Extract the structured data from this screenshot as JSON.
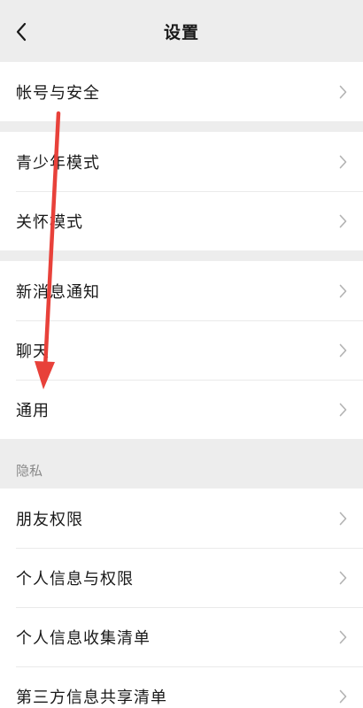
{
  "nav": {
    "title": "设置"
  },
  "groups": [
    {
      "items": [
        {
          "label": "帐号与安全"
        }
      ]
    },
    {
      "items": [
        {
          "label": "青少年模式"
        },
        {
          "label": "关怀模式"
        }
      ]
    },
    {
      "items": [
        {
          "label": "新消息通知"
        },
        {
          "label": "聊天"
        },
        {
          "label": "通用"
        }
      ]
    }
  ],
  "privacy": {
    "header": "隐私",
    "items": [
      {
        "label": "朋友权限"
      },
      {
        "label": "个人信息与权限"
      },
      {
        "label": "个人信息收集清单"
      },
      {
        "label": "第三方信息共享清单"
      }
    ]
  },
  "colors": {
    "background": "#EDEDED",
    "annotation_arrow": "#E8413A"
  },
  "icons": {
    "back": "chevron-left-icon",
    "row": "chevron-right-icon"
  }
}
